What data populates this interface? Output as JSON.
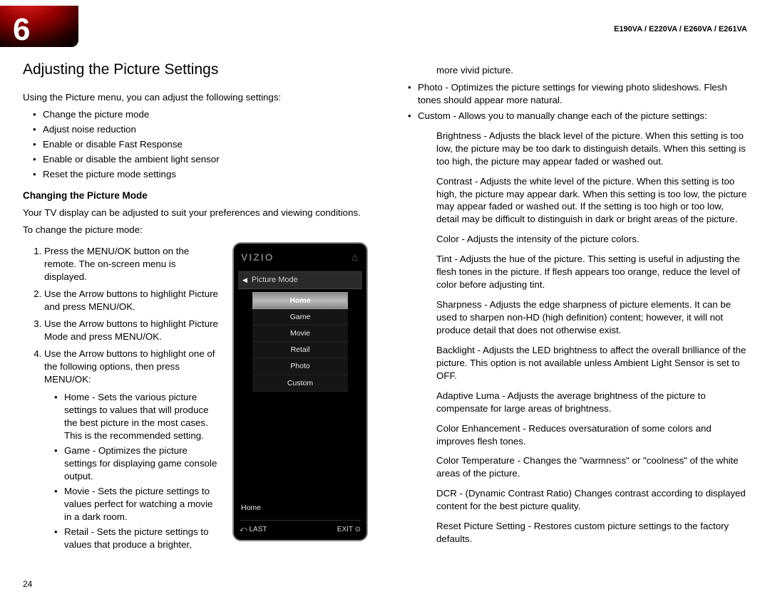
{
  "page_badge_number": "6",
  "model_line": "E190VA / E220VA / E260VA / E261VA",
  "page_number": "24",
  "h1": "Adjusting the Picture Settings",
  "intro": "Using the Picture menu, you can adjust the following settings:",
  "intro_bullets": [
    "Change the picture mode",
    "Adjust noise reduction",
    "Enable or disable Fast Response",
    "Enable or disable the ambient light sensor",
    "Reset the picture mode settings"
  ],
  "sub_heading": "Changing the Picture Mode",
  "sub_intro": "Your TV display can be adjusted to suit your preferences and viewing conditions.",
  "to_change": "To change the picture mode:",
  "steps": [
    "Press the MENU/OK button on the remote. The on-screen menu is displayed.",
    "Use the Arrow buttons to highlight Picture and press MENU/OK.",
    "Use the Arrow buttons to highlight Picture Mode and press MENU/OK.",
    "Use the Arrow buttons to highlight one of the following options, then press MENU/OK:"
  ],
  "mode_bullets": [
    "Home - Sets the various picture settings to values that will produce the best picture in the most cases. This is the recommended setting.",
    "Game - Optimizes the picture settings for displaying game console output.",
    "Movie - Sets the picture settings to values perfect for watching a movie in a dark room.",
    "Retail - Sets the picture settings to values that produce a brighter,"
  ],
  "col2_top": "more vivid picture.",
  "col2_bullets": [
    "Photo - Optimizes the picture settings for viewing photo slideshows. Flesh tones should appear more natural.",
    "Custom - Allows you to manually change each of the picture settings:"
  ],
  "defs": [
    "Brightness - Adjusts the black level of the picture. When this setting is too low, the picture may be too dark to distinguish details. When this setting is too high, the picture may appear faded or washed out.",
    "Contrast - Adjusts the white level of the picture. When this setting is too high, the picture may appear dark. When this setting is too low, the picture may appear faded or washed out. If the setting is too high or too low, detail may be difficult to distinguish in dark or bright areas of the picture.",
    "Color - Adjusts the intensity of the picture colors.",
    "Tint - Adjusts the hue of the picture. This setting is useful in adjusting the flesh tones in the picture. If flesh appears too orange, reduce the level of color before adjusting tint.",
    "Sharpness - Adjusts the edge sharpness of picture elements. It can be used to sharpen non-HD (high definition) content; however, it will not produce detail that does not otherwise exist.",
    "Backlight - Adjusts the LED brightness to affect the overall brilliance of the picture. This option is not available unless Ambient Light Sensor is set to OFF.",
    "Adaptive Luma - Adjusts the average brightness of the picture to compensate for large areas of brightness.",
    "Color Enhancement - Reduces oversaturation of some colors and improves flesh tones.",
    "Color Temperature - Changes the \"warmness\" or \"coolness\" of the white areas of the picture.",
    "DCR - (Dynamic Contrast Ratio) Changes contrast according to displayed content for the best picture quality.",
    "Reset Picture Setting - Restores custom picture settings to the factory defaults."
  ],
  "tv": {
    "logo": "VIZIO",
    "home_icon": "⌂",
    "header": "Picture Mode",
    "items": [
      "Home",
      "Game",
      "Movie",
      "Retail",
      "Photo",
      "Custom"
    ],
    "status": "Home",
    "footer_left": "LAST",
    "footer_left_icon": "⤺",
    "footer_right": "EXIT",
    "footer_right_icon": "⊙"
  }
}
